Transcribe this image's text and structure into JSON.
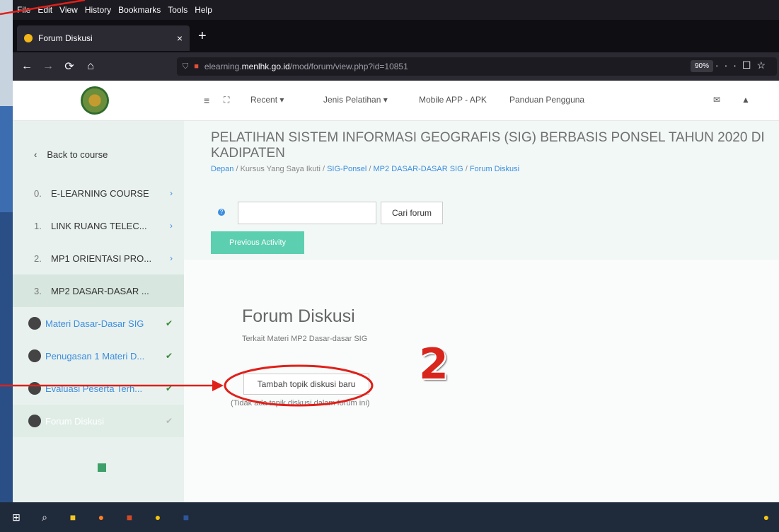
{
  "menubar": {
    "items": [
      "File",
      "Edit",
      "View",
      "History",
      "Bookmarks",
      "Tools",
      "Help"
    ]
  },
  "tab": {
    "title": "Forum Diskusi",
    "close": "×",
    "new_tab": "+"
  },
  "navbar": {
    "url_prefix": "elearning.",
    "url_domain": "menlhk.go.id",
    "url_path": "/mod/forum/view.php?id=10851",
    "zoom": "90%",
    "icons": [
      "back-icon",
      "forward-icon",
      "reload-icon",
      "home-icon"
    ]
  },
  "topnav": {
    "recent": "Recent",
    "jenis": "Jenis Pelatihan",
    "mobile": "Mobile APP - APK",
    "panduan": "Panduan Pengguna"
  },
  "sidebar": {
    "back": "Back to course",
    "items": [
      {
        "num": "0.",
        "label": "E-LEARNING COURSE"
      },
      {
        "num": "1.",
        "label": "LINK RUANG TELEC..."
      },
      {
        "num": "2.",
        "label": "MP1 ORIENTASI PRO..."
      },
      {
        "num": "3.",
        "label": "MP2 DASAR-DASAR ..."
      }
    ],
    "subs": [
      {
        "label": "Materi Dasar-Dasar SIG"
      },
      {
        "label": "Penugasan 1 Materi D..."
      },
      {
        "label": "Evaluasi Peserta Terh..."
      },
      {
        "label": "Forum Diskusi"
      }
    ]
  },
  "course": {
    "title": "PELATIHAN SISTEM INFORMASI GEOGRAFIS (SIG) BERBASIS PONSEL TAHUN 2020 DI KADIPATEN",
    "breadcrumb": [
      "Depan",
      "Kursus Yang Saya Ikuti",
      "SIG-Ponsel",
      "MP2 DASAR-DASAR SIG",
      "Forum Diskusi"
    ]
  },
  "search": {
    "button": "Cari forum",
    "value": ""
  },
  "prev_activity": "Previous Activity",
  "forum": {
    "title": "Forum Diskusi",
    "description": "Terkait Materi MP2 Dasar-dasar SIG",
    "add_button": "Tambah topik diskusi baru",
    "no_topics": "(Tidak ada topik diskusi dalam forum ini)"
  },
  "annotation": {
    "number": "2",
    "color": "#d9261c"
  }
}
